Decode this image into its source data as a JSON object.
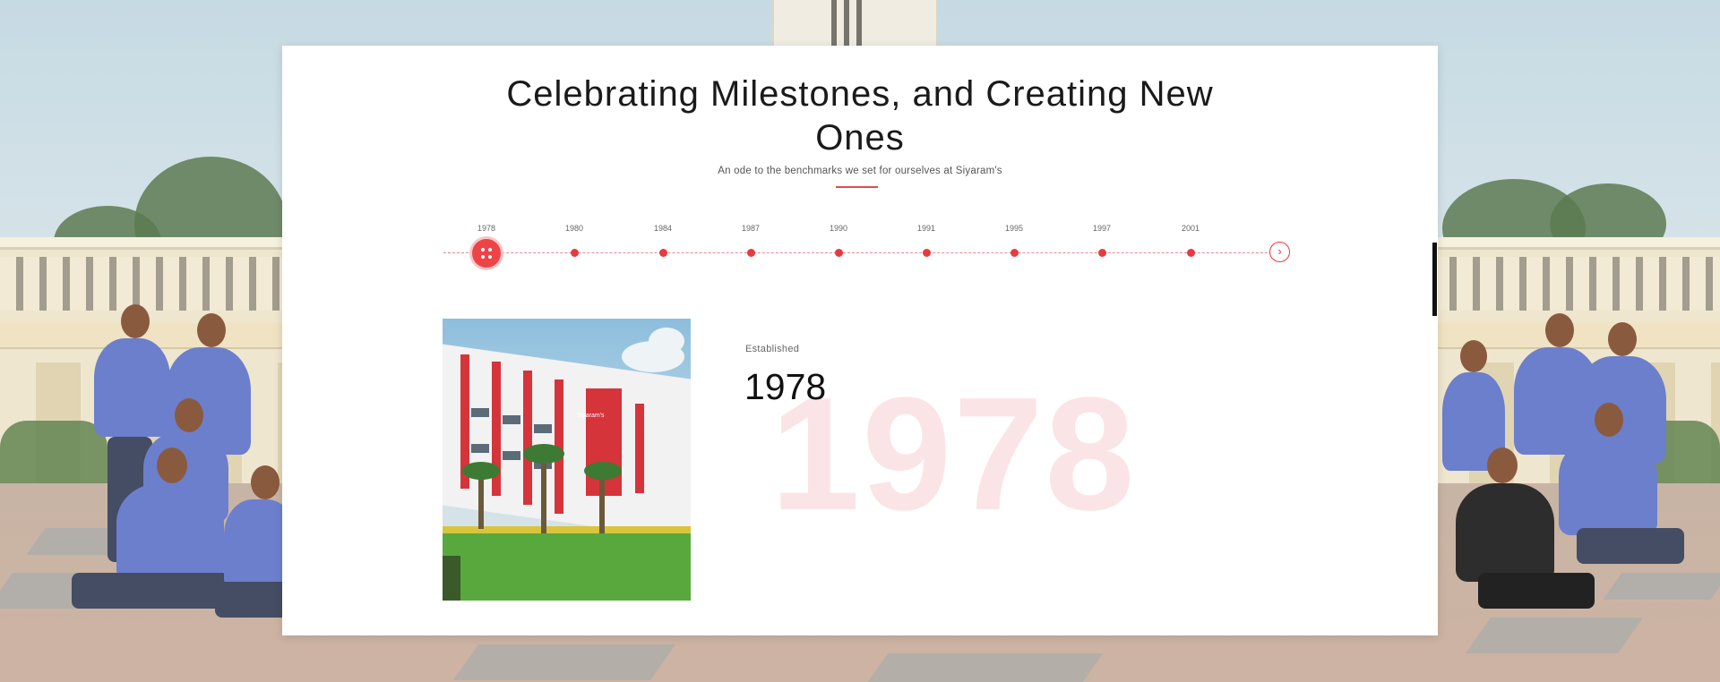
{
  "header": {
    "title": "Celebrating Milestones, and Creating New Ones",
    "subtitle": "An ode to the benchmarks we set for ourselves at Siyaram's"
  },
  "timeline": {
    "years": [
      "1978",
      "1980",
      "1984",
      "1987",
      "1990",
      "1991",
      "1995",
      "1997",
      "2001"
    ],
    "active_year": "1978",
    "next_icon": "chevron-right-icon"
  },
  "milestone": {
    "label": "Established",
    "year": "1978",
    "watermark": "1978",
    "image_sign": "Siyaram's"
  },
  "colors": {
    "accent": "#e8393f",
    "watermark": "#fbe4e6",
    "card_bg": "#ffffff"
  }
}
